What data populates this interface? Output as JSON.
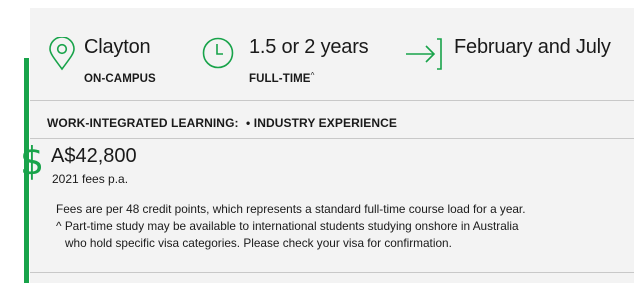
{
  "info_items": [
    {
      "icon": "location-pin-icon",
      "title": "Clayton",
      "subtitle": "ON-CAMPUS"
    },
    {
      "icon": "clock-icon",
      "title": "1.5 or 2 years",
      "subtitle": "FULL-TIME",
      "subtitle_mark": "^"
    },
    {
      "icon": "arrow-in-icon",
      "title": "February and July"
    }
  ],
  "wil": {
    "label": "WORK-INTEGRATED LEARNING:",
    "item": "• INDUSTRY EXPERIENCE"
  },
  "fees": {
    "icon": "dollar-icon",
    "amount": "A$42,800",
    "note": "2021 fees p.a.",
    "line1": "Fees are per 48 credit points, which represents a standard full-time course load for a year.",
    "line2": "^ Part-time study may be available to international students studying onshore in Australia",
    "line3": "who hold specific visa categories. Please check your visa for confirmation."
  },
  "colors": {
    "accent": "#18a34a",
    "panel": "#f3f3f3",
    "divider": "#c8c8c8"
  }
}
